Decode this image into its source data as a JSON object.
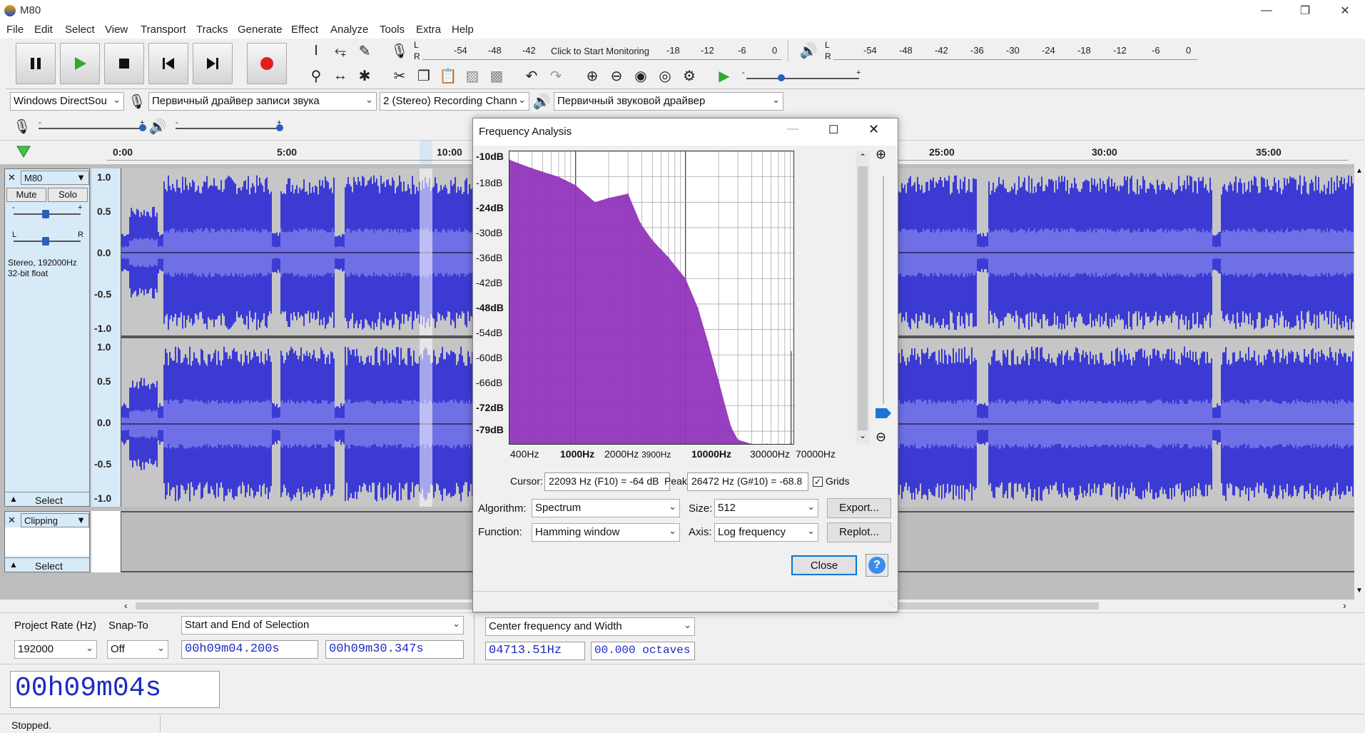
{
  "window": {
    "title": "M80"
  },
  "menu": [
    "File",
    "Edit",
    "Select",
    "View",
    "Transport",
    "Tracks",
    "Generate",
    "Effect",
    "Analyze",
    "Tools",
    "Extra",
    "Help"
  ],
  "meters": {
    "record_label": "Click to Start Monitoring",
    "record_ticks": [
      "-54",
      "-48",
      "-42",
      "-18",
      "-12",
      "-6",
      "0"
    ],
    "play_ticks": [
      "-54",
      "-48",
      "-42",
      "-36",
      "-30",
      "-24",
      "-18",
      "-12",
      "-6",
      "0"
    ],
    "lr": [
      "L",
      "R"
    ]
  },
  "devices": {
    "host": "Windows DirectSou",
    "rec_device": "Первичный драйвер записи звука",
    "channels": "2 (Stereo) Recording Chann",
    "play_device": "Первичный звуковой драйвер"
  },
  "timeline": {
    "labels": [
      "0:00",
      "5:00",
      "10:00",
      "25:00",
      "30:00",
      "35:00"
    ]
  },
  "track1": {
    "name": "M80",
    "mute": "Mute",
    "solo": "Solo",
    "gain_minus": "-",
    "gain_plus": "+",
    "pan_l": "L",
    "pan_r": "R",
    "info1": "Stereo, 192000Hz",
    "info2": "32-bit float",
    "select": "Select",
    "scale": [
      "1.0",
      "0.5",
      "0.0",
      "-0.5",
      "-1.0"
    ]
  },
  "track2": {
    "name": "Clipping",
    "select": "Select"
  },
  "dialog": {
    "title": "Frequency Analysis",
    "db_labels": [
      "-10dB",
      "-18dB",
      "-24dB",
      "-30dB",
      "-36dB",
      "-42dB",
      "-48dB",
      "-54dB",
      "-60dB",
      "-66dB",
      "-72dB",
      "-79dB"
    ],
    "hz_labels": [
      "400Hz",
      "1000Hz",
      "2000Hz",
      "3900Hz",
      "10000Hz",
      "30000Hz",
      "70000Hz"
    ],
    "cursor_label": "Cursor:",
    "cursor_value": "22093 Hz (F10) = -64 dB",
    "peak_label": "Peak:",
    "peak_value": "26472 Hz (G#10) = -68.8",
    "grids_label": "Grids",
    "algorithm_label": "Algorithm:",
    "algorithm_value": "Spectrum",
    "size_label": "Size:",
    "size_value": "512",
    "function_label": "Function:",
    "function_value": "Hamming window",
    "axis_label": "Axis:",
    "axis_value": "Log frequency",
    "export": "Export...",
    "replot": "Replot...",
    "close": "Close",
    "help": "?"
  },
  "chart_data": {
    "type": "area",
    "xlabel": "",
    "ylabel": "",
    "x_scale": "log",
    "x": [
      250,
      400,
      700,
      1000,
      1500,
      2000,
      3000,
      3900,
      5000,
      7000,
      10000,
      13000,
      16000,
      20000,
      23000,
      26000,
      30000,
      40000,
      55000,
      70000,
      90000
    ],
    "y": [
      -12,
      -14,
      -16,
      -18,
      -22,
      -21,
      -20,
      -27,
      -31,
      -35,
      -40,
      -47,
      -55,
      -64,
      -70,
      -75,
      -78,
      -79,
      -79,
      -79,
      -79
    ],
    "ylim": [
      -79,
      -10
    ],
    "grid": true,
    "fill_color": "#8e2fb8"
  },
  "bottom": {
    "rate_label": "Project Rate (Hz)",
    "rate_value": "192000",
    "snap_label": "Snap-To",
    "snap_value": "Off",
    "sel_mode": "Start and End of Selection",
    "sel_start": "00h09m04.200s",
    "sel_end": "00h09m30.347s",
    "spec_mode": "Center frequency and Width",
    "center_freq": "04713.51Hz",
    "width": "00.000 octaves",
    "big_time": "00h09m04s",
    "status": "Stopped."
  },
  "colors": {
    "wave": "#3b3bd4",
    "wave_rms": "#6f70e6",
    "spectrum": "#8e2fb8",
    "track_bg": "#bdbdbd"
  }
}
